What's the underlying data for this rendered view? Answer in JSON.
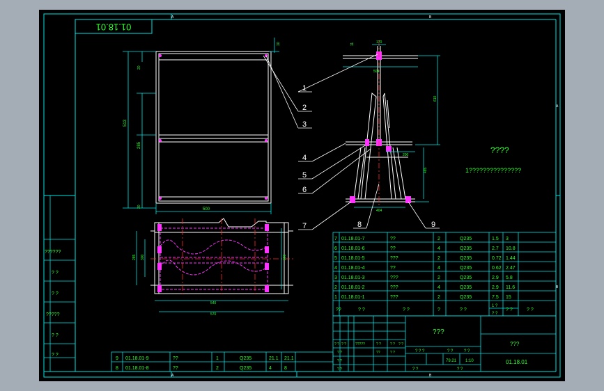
{
  "drawing_code": "01.18.01",
  "drawing_code_box": "01.18.01",
  "zone_letters": {
    "top": [
      "A",
      "B"
    ],
    "right": [
      "A",
      "B"
    ],
    "bottom": [
      "A",
      "B"
    ]
  },
  "tech_title": "????",
  "tech_note": "1???????????????",
  "balloons": [
    "1",
    "2",
    "3",
    "4",
    "5",
    "6",
    "7",
    "8",
    "9"
  ],
  "dims": {
    "d10": "10",
    "d20": "20",
    "d50": "50",
    "d80": "80",
    "d513": "513",
    "d285": "285",
    "d500": "500",
    "d285b": "285",
    "d300": "300",
    "d606": "606",
    "d540": "540",
    "d570": "570",
    "d170": "170",
    "d11": "11",
    "d504": "504",
    "d610": "610",
    "d200": "200",
    "d485": "485",
    "d404": "404"
  },
  "bom_rows": [
    {
      "no": "7",
      "code": "01.18.01-7",
      "name": "??",
      "qty": "2",
      "mat": "Q235",
      "w1": "1.5",
      "w2": "3"
    },
    {
      "no": "6",
      "code": "01.18.01-6",
      "name": "??",
      "qty": "4",
      "mat": "Q235",
      "w1": "2.7",
      "w2": "10.8"
    },
    {
      "no": "5",
      "code": "01.18.01-5",
      "name": "???",
      "qty": "2",
      "mat": "Q235",
      "w1": "0.72",
      "w2": "1.44"
    },
    {
      "no": "4",
      "code": "01.18.01-4",
      "name": "??",
      "qty": "4",
      "mat": "Q235",
      "w1": "0.62",
      "w2": "2.47"
    },
    {
      "no": "3",
      "code": "01.18.01-3",
      "name": "???",
      "qty": "2",
      "mat": "Q235",
      "w1": "2.9",
      "w2": "5.8"
    },
    {
      "no": "2",
      "code": "01.18.01-2",
      "name": "???",
      "qty": "4",
      "mat": "Q235",
      "w1": "2.9",
      "w2": "11.6"
    },
    {
      "no": "1",
      "code": "01.18.01-1",
      "name": "???",
      "qty": "2",
      "mat": "Q235",
      "w1": "7.5",
      "w2": "15"
    }
  ],
  "bom_header": {
    "no": "??",
    "code": "? ?",
    "name": "? ?",
    "qty": "?",
    "mat": "? ?",
    "w1": "1 ?",
    "w1b": "? ?",
    "w2": "? ?",
    "rem": "? ?"
  },
  "lower_rows": [
    {
      "no": "9",
      "code": "01.18.01-9",
      "name": "??",
      "qty": "1",
      "mat": "Q235",
      "w1": "21.1",
      "w2": "21.1"
    },
    {
      "no": "8",
      "code": "01.18.01-8",
      "name": "??",
      "qty": "2",
      "mat": "Q235",
      "w1": "4",
      "w2": "8"
    }
  ],
  "side_labels": [
    "??????",
    "? ?",
    "? ?",
    "?????",
    "? ?",
    "? ?"
  ],
  "title_block": {
    "name": "???",
    "company": "???",
    "code": "01.18.01",
    "sign_labels": [
      "? ?",
      "? ?",
      "?????",
      "? ?",
      "? ?",
      "? ?"
    ],
    "row_a": [
      "? ?",
      "??",
      "? ?"
    ],
    "row_b": [
      "? ?"
    ],
    "row_c": [
      "? ?"
    ],
    "scale_hdr": [
      "? ? ?",
      "? ?",
      "? ?"
    ],
    "weight": "79.21",
    "scale": "1:10",
    "sheets": "? ?",
    "sheet_no": "? ?"
  },
  "colors": {
    "frame": "#00e5e5",
    "text": "#2cff2c",
    "part": "#ffffff",
    "center": "#ff2a2a",
    "hidden": "#ff33ff",
    "background": "#000000"
  }
}
